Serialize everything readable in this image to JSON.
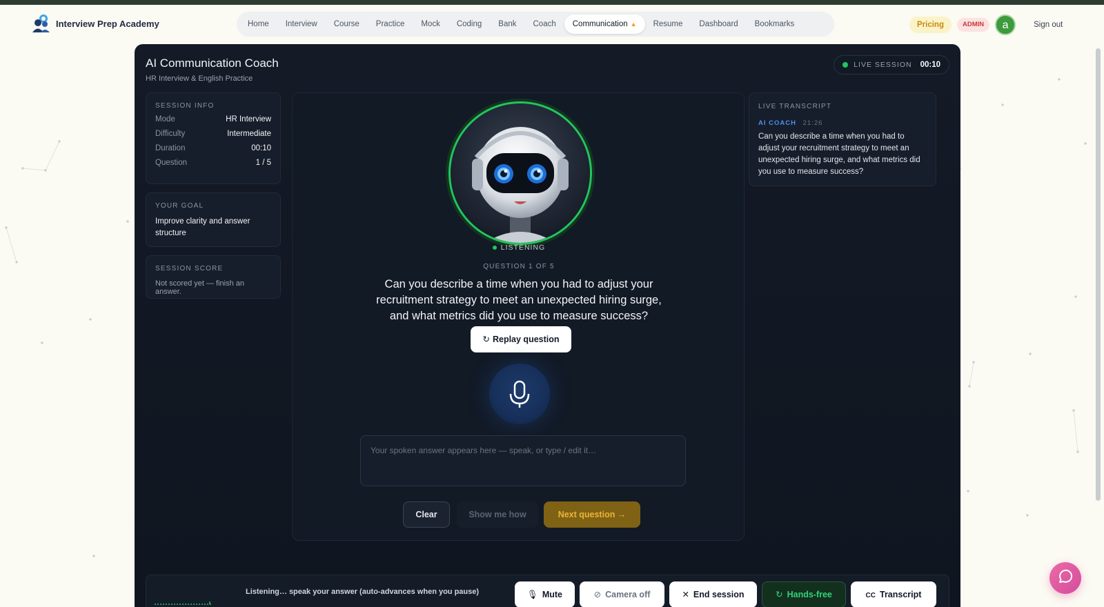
{
  "brand": {
    "name": "Interview Prep Academy"
  },
  "nav": {
    "items": [
      {
        "label": "Home"
      },
      {
        "label": "Interview"
      },
      {
        "label": "Course"
      },
      {
        "label": "Practice"
      },
      {
        "label": "Mock"
      },
      {
        "label": "Coding"
      },
      {
        "label": "Bank"
      },
      {
        "label": "Coach"
      },
      {
        "label": "Communication"
      },
      {
        "label": "Resume"
      },
      {
        "label": "Dashboard"
      },
      {
        "label": "Bookmarks"
      }
    ],
    "active": "Communication",
    "pricing": "Pricing",
    "admin": "ADMIN",
    "avatar_letter": "a",
    "signout": "Sign out"
  },
  "header": {
    "title": "AI Communication Coach",
    "subtitle": "HR Interview & English Practice",
    "live_label": "LIVE SESSION",
    "live_timer": "00:10"
  },
  "session_info": {
    "label": "SESSION INFO",
    "rows": [
      {
        "key": "Mode",
        "value": "HR Interview"
      },
      {
        "key": "Difficulty",
        "value": "Intermediate"
      },
      {
        "key": "Duration",
        "value": "00:10"
      },
      {
        "key": "Question",
        "value": "1 / 5"
      }
    ]
  },
  "goal": {
    "label": "YOUR GOAL",
    "text": "Improve clarity and answer structure"
  },
  "score": {
    "label": "SESSION SCORE",
    "text": "Not scored yet — finish an answer."
  },
  "stage": {
    "status": "LISTENING",
    "question_label": "QUESTION 1 OF 5",
    "question": "Can you describe a time when you had to adjust your recruitment strategy to meet an unexpected hiring surge, and what metrics did you use to measure success?",
    "replay": "Replay question",
    "answer_placeholder": "Your spoken answer appears here — speak, or type / edit it…",
    "clear": "Clear",
    "show_me_how": "Show me how",
    "next": "Next question →"
  },
  "transcript": {
    "label": "LIVE TRANSCRIPT",
    "speaker": "AI COACH",
    "time": "21:26",
    "text": "Can you describe a time when you had to adjust your recruitment strategy to meet an unexpected hiring surge, and what metrics did you use to measure success?"
  },
  "bottom": {
    "status": "Listening… speak your answer (auto-advances when you pause)",
    "mute": "Mute",
    "camera": "Camera off",
    "end": "End session",
    "hands_free": "Hands-free",
    "transcript": "Transcript"
  },
  "colors": {
    "accent_green": "#22c55e",
    "panel_bg": "#141a26",
    "next_bg": "#806214",
    "pricing": "#c88a10",
    "admin": "#c53939",
    "coach_label": "#4f8df5"
  }
}
